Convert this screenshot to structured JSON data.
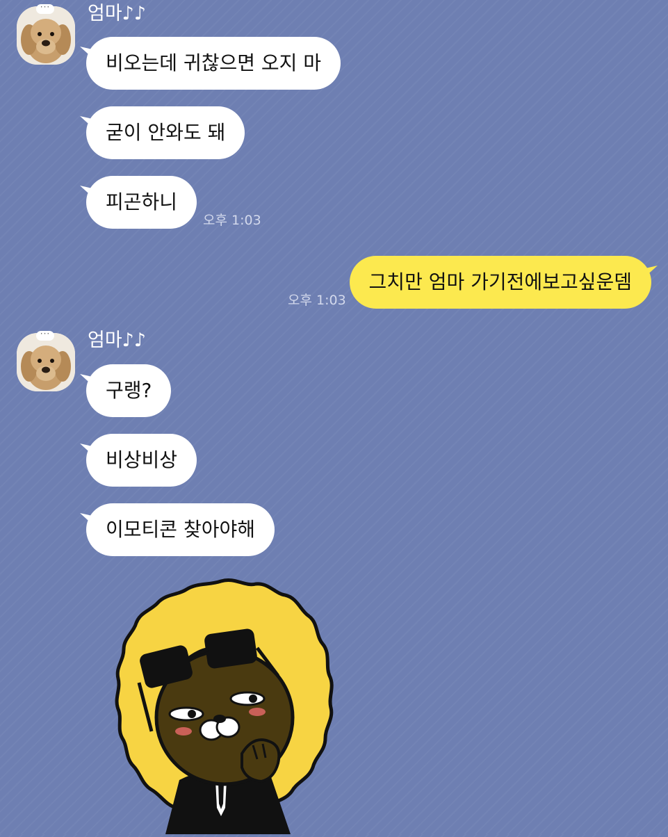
{
  "chat": {
    "groups": [
      {
        "sender": "엄마♪♪",
        "messages": [
          "비오는데 귀찮으면 오지 마",
          "굳이 안와도 돼",
          "피곤하니"
        ],
        "time": "오후 1:03"
      },
      {
        "sender": "엄마♪♪",
        "messages": [
          "구랭?",
          "비상비상",
          "이모티콘 찾아야해"
        ]
      }
    ],
    "outgoing": {
      "text": "그치만 엄마 가기전에보고싶운뎀",
      "time": "오후 1:03"
    },
    "avatar_dots": "···"
  },
  "colors": {
    "background": "#6e7fb2",
    "incoming_bubble": "#ffffff",
    "outgoing_bubble": "#fce94f",
    "sticker_mane": "#f7d443",
    "sticker_face": "#4a3a10"
  },
  "icons": {
    "avatar": "dog-plush-avatar",
    "sticker": "lion-with-sunglasses-sticker"
  }
}
